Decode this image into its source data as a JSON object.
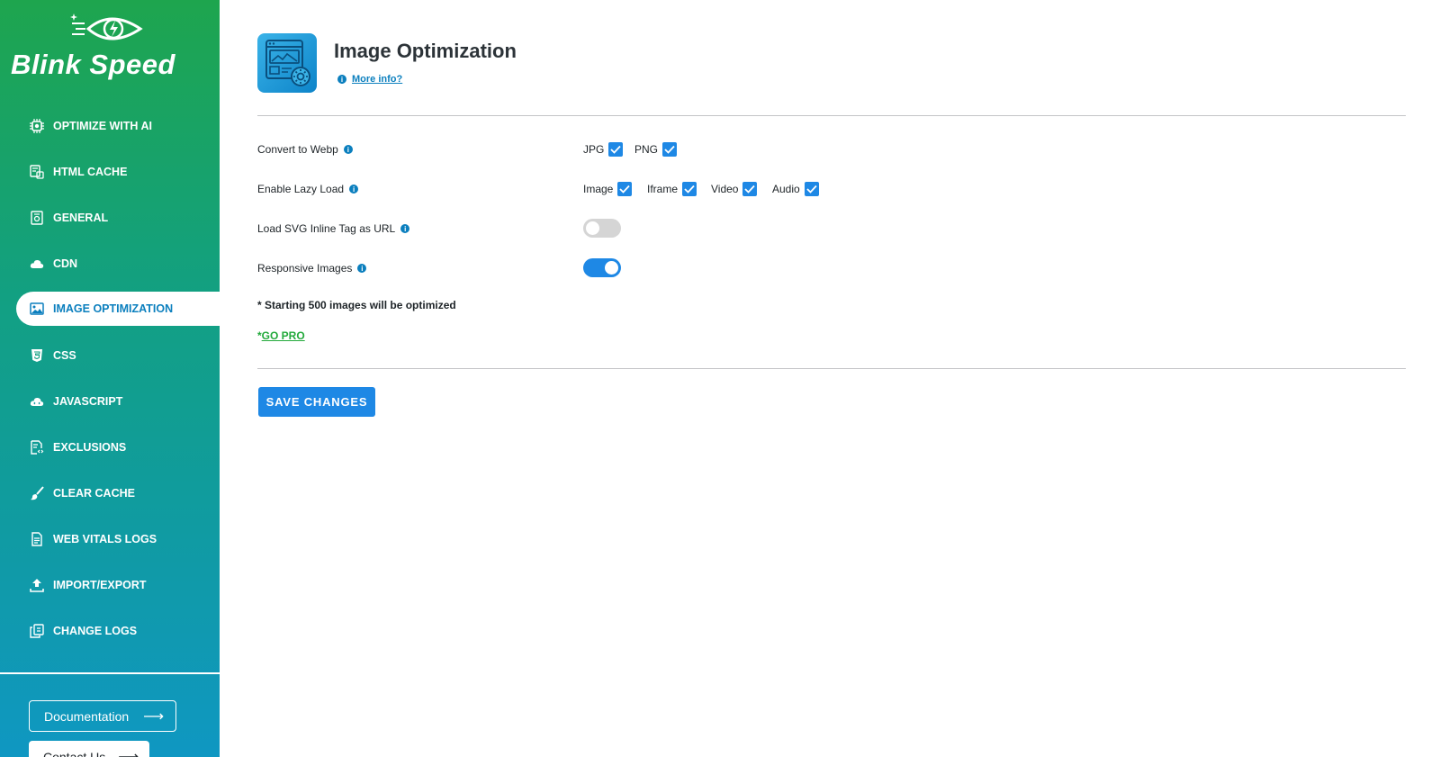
{
  "brand": {
    "name_part1": "Blink",
    "name_part2": "Speed"
  },
  "sidebar": {
    "items": [
      {
        "label": "OPTIMIZE WITH AI",
        "icon": "ai-chip-icon",
        "active": false
      },
      {
        "label": "HTML CACHE",
        "icon": "html-cache-icon",
        "active": false
      },
      {
        "label": "GENERAL",
        "icon": "general-settings-icon",
        "active": false
      },
      {
        "label": "CDN",
        "icon": "cloud-icon",
        "active": false
      },
      {
        "label": "IMAGE OPTIMIZATION",
        "icon": "image-icon",
        "active": true
      },
      {
        "label": "CSS",
        "icon": "css-icon",
        "active": false
      },
      {
        "label": "JAVASCRIPT",
        "icon": "javascript-cloud-icon",
        "active": false
      },
      {
        "label": "EXCLUSIONS",
        "icon": "exclusions-file-icon",
        "active": false
      },
      {
        "label": "CLEAR CACHE",
        "icon": "brush-icon",
        "active": false
      },
      {
        "label": "WEB VITALS LOGS",
        "icon": "log-file-icon",
        "active": false
      },
      {
        "label": "IMPORT/EXPORT",
        "icon": "upload-icon",
        "active": false
      },
      {
        "label": "CHANGE LOGS",
        "icon": "copy-logs-icon",
        "active": false
      }
    ],
    "documentation_label": "Documentation",
    "contact_label": "Contact Us"
  },
  "header": {
    "title": "Image Optimization",
    "more_info": "More info?"
  },
  "settings": {
    "convert_webp": {
      "label": "Convert to Webp",
      "options": [
        {
          "label": "JPG",
          "checked": true
        },
        {
          "label": "PNG",
          "checked": true
        }
      ]
    },
    "lazy_load": {
      "label": "Enable Lazy Load",
      "options": [
        {
          "label": "Image",
          "checked": true
        },
        {
          "label": "Iframe",
          "checked": true
        },
        {
          "label": "Video",
          "checked": true
        },
        {
          "label": "Audio",
          "checked": true
        }
      ]
    },
    "svg_inline": {
      "label": "Load SVG Inline Tag as URL",
      "enabled": false
    },
    "responsive_images": {
      "label": "Responsive Images",
      "enabled": true
    }
  },
  "note": "* Starting 500 images will be optimized",
  "go_pro": {
    "prefix": "*",
    "label": "GO PRO"
  },
  "save_label": "SAVE CHANGES",
  "colors": {
    "accent": "#1e88e5",
    "sidebar_top": "#1ea54e",
    "sidebar_bottom": "#0f97c2",
    "pro_green": "#22a93b"
  }
}
